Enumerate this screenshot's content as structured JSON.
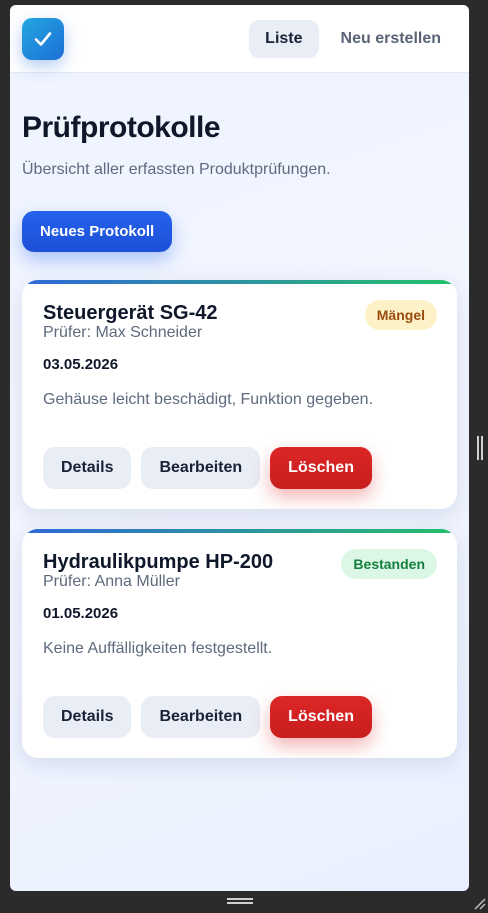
{
  "header": {
    "logo_icon": "checkmark-icon",
    "nav": [
      {
        "label": "Liste",
        "active": true
      },
      {
        "label": "Neu erstellen",
        "active": false
      }
    ]
  },
  "page": {
    "title": "Prüfprotokolle",
    "subtitle": "Übersicht aller erfassten Produktprüfungen.",
    "new_button": "Neues Protokoll"
  },
  "protocols": [
    {
      "product": "Steuergerät SG-42",
      "inspector": "Prüfer: Max Schneider",
      "date": "03.05.2026",
      "note": "Gehäuse leicht beschädigt, Funktion gegeben.",
      "status": "Mängel",
      "status_color": "#9a4a0e"
    },
    {
      "product": "Hydraulikpumpe HP-200",
      "inspector": "Prüfer: Anna Müller",
      "date": "01.05.2026",
      "note": "Keine Auffälligkeiten festgestellt.",
      "status": "Bestanden",
      "status_color": "#15803d"
    }
  ],
  "actions": {
    "details": "Details",
    "edit": "Bearbeiten",
    "delete": "Löschen"
  },
  "colors": {
    "primary": "#2563eb",
    "danger": "#dc2626",
    "success": "#15803d",
    "warning": "#9a4a0e"
  }
}
